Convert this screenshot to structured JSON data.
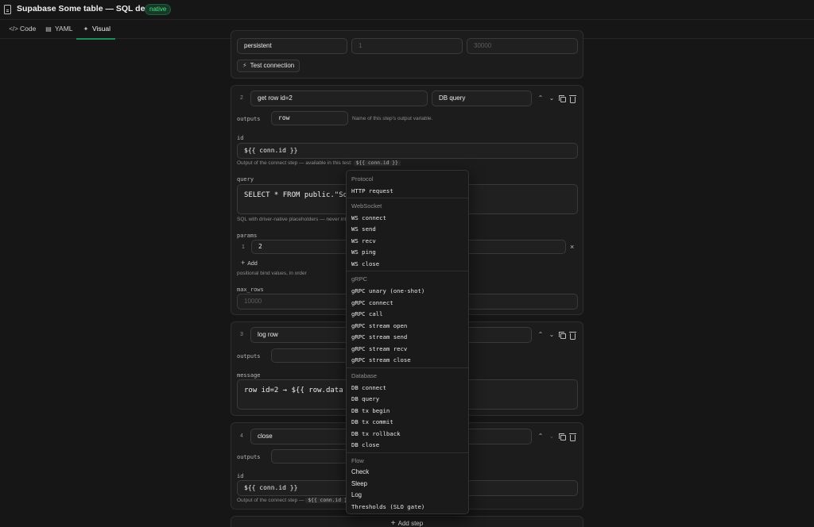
{
  "header": {
    "title": "Supabase Some table — SQL demo",
    "badge": "native"
  },
  "tabs": [
    {
      "label": "Code",
      "icon": "</>"
    },
    {
      "label": "YAML",
      "icon": "▤"
    },
    {
      "label": "Visual",
      "icon": "✦"
    }
  ],
  "step1": {
    "mode_value": "persistent",
    "field2_placeholder": "1",
    "field3_placeholder": "30000",
    "test_button": "Test connection"
  },
  "step2": {
    "num": "2",
    "name": "get row id=2",
    "type": "DB query",
    "outputs_label": "outputs",
    "outputs_value": "row",
    "outputs_help": "Name of this step's output variable.",
    "id_label": "id",
    "id_value": "${{ conn.id }}",
    "id_help": "Output of the connect step — available in this test:",
    "id_help_code": "${{ conn.id }}",
    "query_label": "query",
    "query_value": "SELECT * FROM public.\"Some",
    "query_help": "SQL with driver-native placeholders — never inte",
    "params_label": "params",
    "param_index": "1",
    "param_value": "2",
    "add_label": "Add",
    "params_help": "positional bind values, in order",
    "maxrows_label": "max_rows",
    "maxrows_placeholder": "10000"
  },
  "step3": {
    "num": "3",
    "name": "log row",
    "outputs_label": "outputs",
    "message_label": "message",
    "message_value": "row id=2 → ${{ row.data }"
  },
  "step4": {
    "num": "4",
    "name": "close",
    "outputs_label": "outputs",
    "id_label": "id",
    "id_value": "${{ conn.id }}",
    "id_help": "Output of the connect step —",
    "id_help_code": "${{ conn.id }}"
  },
  "menu": {
    "groups": [
      {
        "title": "Protocol",
        "items": [
          "HTTP request"
        ]
      },
      {
        "title": "WebSocket",
        "items": [
          "WS connect",
          "WS send",
          "WS recv",
          "WS ping",
          "WS close"
        ]
      },
      {
        "title": "gRPC",
        "items": [
          "gRPC unary (one-shot)",
          "gRPC connect",
          "gRPC call",
          "gRPC stream open",
          "gRPC stream send",
          "gRPC stream recv",
          "gRPC stream close"
        ]
      },
      {
        "title": "Database",
        "items": [
          "DB connect",
          "DB query",
          "DB tx begin",
          "DB tx commit",
          "DB tx rollback",
          "DB close"
        ]
      },
      {
        "title": "Flow",
        "items": [
          "Check",
          "Sleep",
          "Log",
          "Thresholds (SLO gate)"
        ]
      }
    ]
  },
  "add_step": "Add step"
}
